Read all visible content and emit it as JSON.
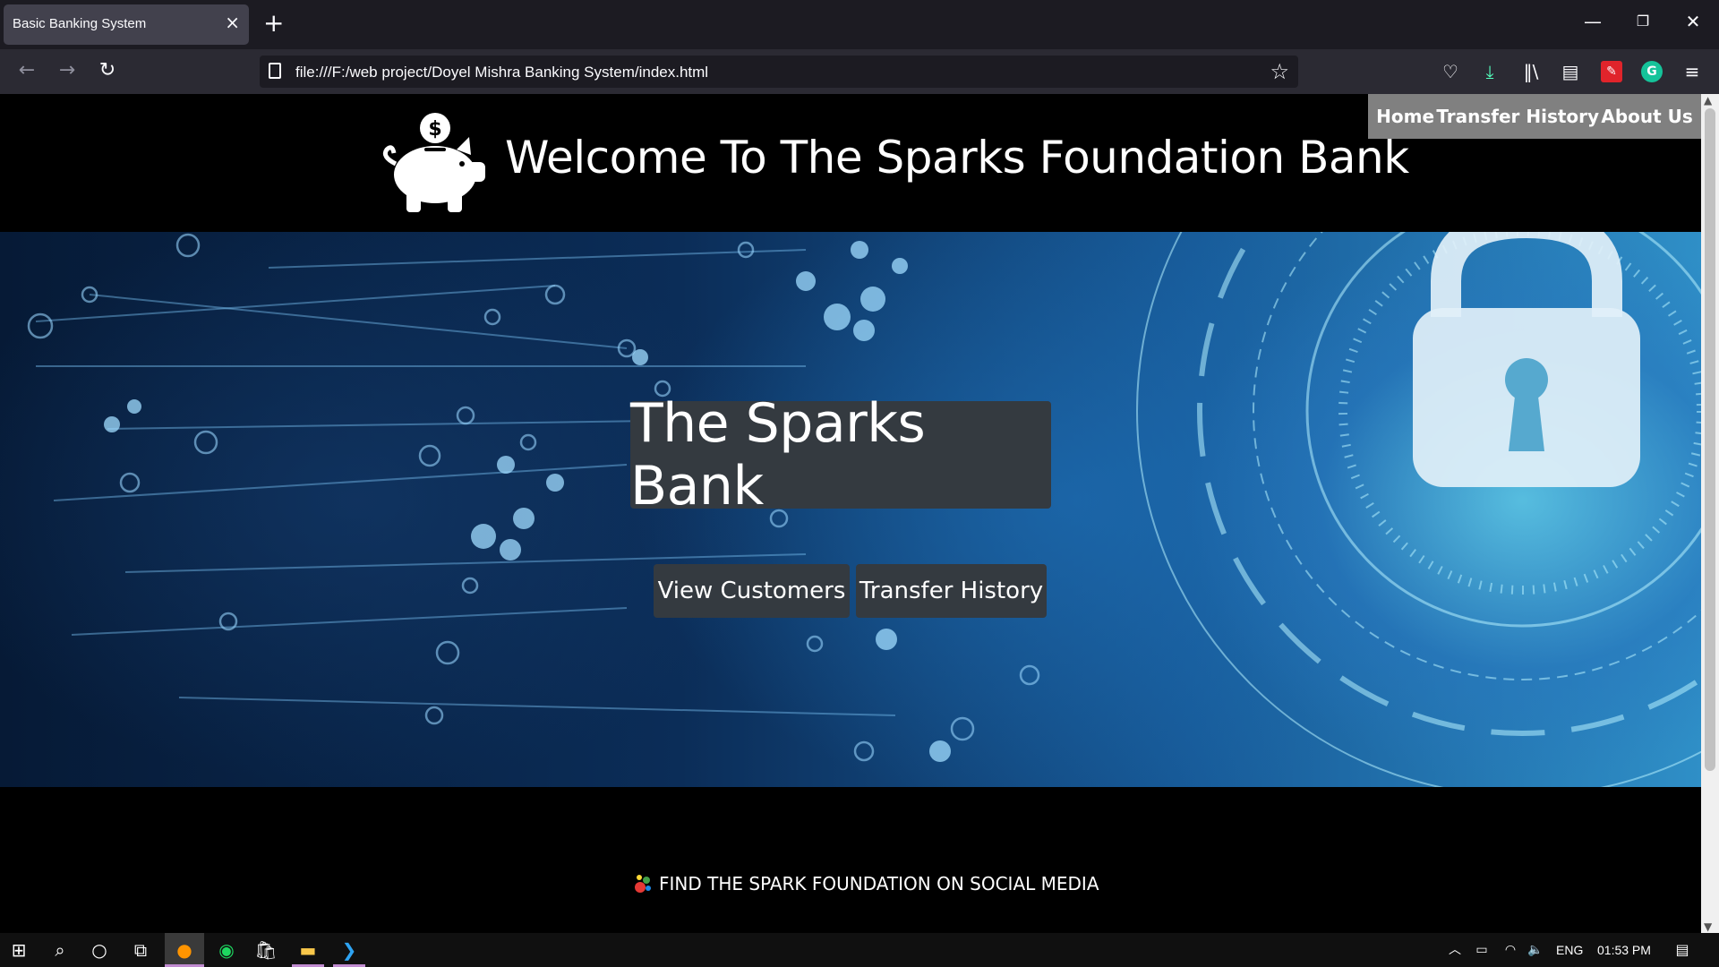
{
  "browser": {
    "tab_title": "Basic Banking System",
    "tab_close": "×",
    "new_tab": "+",
    "url": "file:///F:/web project/Doyel Mishra Banking System/index.html",
    "window_controls": [
      "minimize-icon",
      "restore-icon",
      "close-icon"
    ],
    "toolbar_icons": [
      "pocket-icon",
      "download-icon",
      "library-icon",
      "sidebar-icon",
      "extension-icon",
      "grammarly-icon",
      "menu-icon"
    ]
  },
  "site": {
    "nav": {
      "home": "Home",
      "transfer_history": "Transfer History",
      "about": "About Us"
    },
    "title": "Welcome To The Sparks Foundation Bank",
    "hero_title": "The Sparks Bank",
    "buttons": {
      "view_customers": "View Customers",
      "transfer_history": "Transfer History"
    },
    "footer": "FIND THE SPARK FOUNDATION ON SOCIAL MEDIA"
  },
  "taskbar": {
    "language": "ENG",
    "time": "01:53 PM"
  },
  "colors": {
    "page_bg": "#000000",
    "nav_bg": "#808080",
    "button_bg": "#343a40",
    "chrome_bg": "#1c1b22"
  }
}
